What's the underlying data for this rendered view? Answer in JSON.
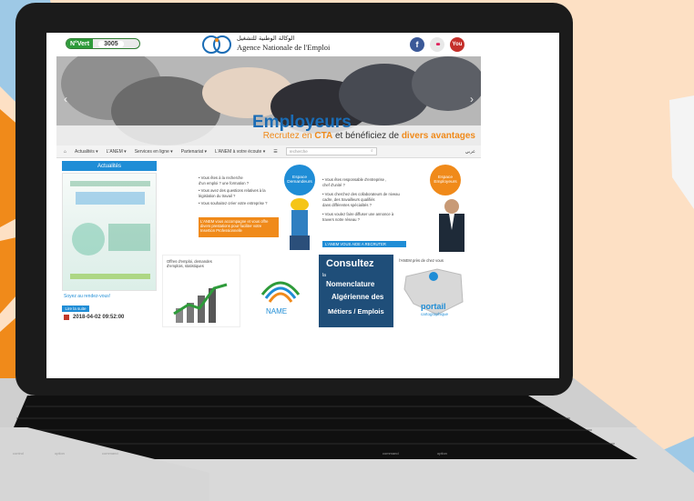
{
  "header": {
    "numero_vert_label": "N°Vert",
    "numero_vert_number": "3005",
    "logo_arabic": "الوكالة الوطنية للتشغيل",
    "logo_french": "Agence Nationale de l'Emploi",
    "social": {
      "facebook": "f",
      "flickr": "••",
      "youtube": "You"
    }
  },
  "hero": {
    "title": "Employeurs",
    "subtitle_part1": "Recrutez en ",
    "subtitle_part2": "CTA",
    "subtitle_part3": " et ",
    "subtitle_part4": "bénéficiez de ",
    "subtitle_part5": "divers avantages",
    "prev_arrow": "‹",
    "next_arrow": "›"
  },
  "nav": {
    "home_icon": "home-icon",
    "items": [
      "Actualités ▾",
      "L'ANEM ▾",
      "Services en ligne ▾",
      "Partenariat ▾",
      "L'ANEM à votre écoute ▾"
    ],
    "search_placeholder": "recherche",
    "lang": "عربي"
  },
  "sidebar": {
    "header": "Actualités",
    "caption": "Soyez au rendez-vous!",
    "read_more": "Lire la suite",
    "date": "2018-04-02 09:52:00"
  },
  "cards": {
    "demandeurs_label": "Espace Demandeurs",
    "employeurs_label": "Espace Employeurs",
    "demandeurs_lines": [
      "• Vous êtes à la recherche",
      "d'un emploi ? une formation ?",
      "• Vous avez des questions relatives à la",
      "législation du travail ?",
      "• Vous souhaitez créer votre entreprise ?"
    ],
    "demandeurs_cta": "L'ANEM vous accompagne et vous offre divers prestations pour faciliter votre Insertion Professionnelle",
    "employeurs_lines": [
      "• Vous êtes responsable d'entreprise ,",
      "chef d'unité ?",
      "• Vous cherchez des collaborateurs de niveau",
      "cadre, des travailleurs qualifiés",
      "dans différentes spécialités ?",
      "• Vous voulez faire diffuser une annonce à",
      "travers notre réseau ?"
    ],
    "employeurs_cta": "L'ANEM VOUS AIDE A RECRUTER",
    "offres_text": "Offres d'emploi, demandes d'emplois, statistiques",
    "name_label": "NAME",
    "consultez_title": "Consultez",
    "consultez_lines": [
      "la",
      "Nomenclature",
      "Algérienne des",
      "Métiers / Emplois"
    ],
    "portail_caption": "l'ANEM près de chez vous",
    "portail_label": "portail",
    "portail_sub": "cartographique"
  },
  "keyboard": {
    "labels": [
      "control",
      "option",
      "command",
      "command",
      "option"
    ]
  },
  "colors": {
    "accent_blue": "#1f8dd6",
    "accent_orange": "#f08a1a",
    "background": "#fde0c4"
  }
}
